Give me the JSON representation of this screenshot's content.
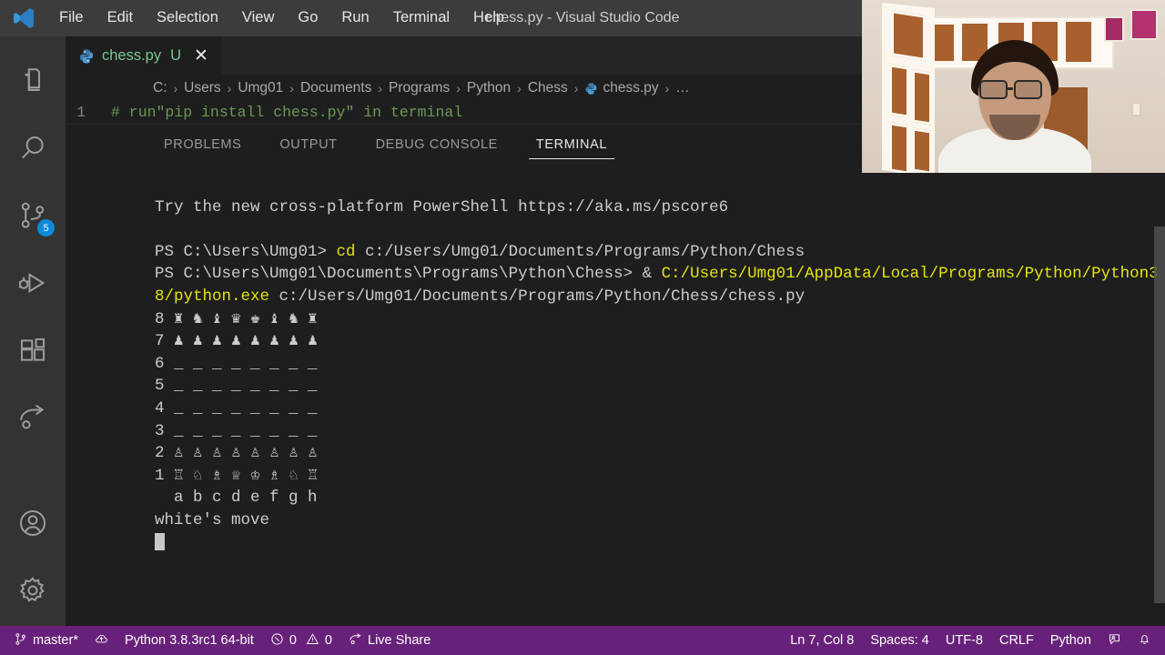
{
  "window": {
    "title": "chess.py - Visual Studio Code"
  },
  "menu": {
    "items": [
      {
        "label": "File"
      },
      {
        "label": "Edit"
      },
      {
        "label": "Selection"
      },
      {
        "label": "View"
      },
      {
        "label": "Go"
      },
      {
        "label": "Run"
      },
      {
        "label": "Terminal"
      },
      {
        "label": "Help"
      }
    ]
  },
  "activitybar": {
    "items": [
      {
        "name": "explorer-icon",
        "badge": ""
      },
      {
        "name": "search-icon",
        "badge": ""
      },
      {
        "name": "source-control-icon",
        "badge": "5"
      },
      {
        "name": "run-and-debug-icon",
        "badge": ""
      },
      {
        "name": "extensions-icon",
        "badge": ""
      },
      {
        "name": "live-share-icon",
        "badge": ""
      },
      {
        "name": "account-icon",
        "badge": ""
      },
      {
        "name": "settings-gear-icon",
        "badge": ""
      }
    ]
  },
  "tab": {
    "icon": "python-file-icon",
    "label": "chess.py",
    "badge": "U",
    "close": "✕"
  },
  "breadcrumbs": {
    "separator": "›",
    "items": [
      {
        "label": "C:"
      },
      {
        "label": "Users"
      },
      {
        "label": "Umg01"
      },
      {
        "label": "Documents"
      },
      {
        "label": "Programs"
      },
      {
        "label": "Python"
      },
      {
        "label": "Chess"
      },
      {
        "label": "chess.py",
        "icon": "python-file-icon"
      },
      {
        "label": "…"
      }
    ]
  },
  "editor": {
    "lines": [
      {
        "number": "1",
        "text": "# run\"pip install chess.py\" in terminal"
      }
    ]
  },
  "panel": {
    "tabs": [
      {
        "label": "PROBLEMS",
        "active": false
      },
      {
        "label": "OUTPUT",
        "active": false
      },
      {
        "label": "DEBUG CONSOLE",
        "active": false
      },
      {
        "label": "TERMINAL",
        "active": true
      }
    ]
  },
  "terminal": {
    "line_banner": "Try the new cross-platform PowerShell https://aka.ms/pscore6",
    "prompt1_prefix": "PS C:\\Users\\Umg01> ",
    "prompt1_cmd": "cd",
    "prompt1_args": " c:/Users/Umg01/Documents/Programs/Python/Chess",
    "prompt2_prefix": "PS C:\\Users\\Umg01\\Documents\\Programs\\Python\\Chess> & ",
    "prompt2_path": "C:/Users/Umg01/AppData/Local/Programs/Python/Python38/python.exe",
    "prompt2_script": " c:/Users/Umg01/Documents/Programs/Python/Chess/chess.py",
    "board": [
      {
        "rank": "8",
        "squares": "♜ ♞ ♝ ♛ ♚ ♝ ♞ ♜"
      },
      {
        "rank": "7",
        "squares": "♟ ♟ ♟ ♟ ♟ ♟ ♟ ♟"
      },
      {
        "rank": "6",
        "squares": "_ _ _ _ _ _ _ _"
      },
      {
        "rank": "5",
        "squares": "_ _ _ _ _ _ _ _"
      },
      {
        "rank": "4",
        "squares": "_ _ _ _ _ _ _ _"
      },
      {
        "rank": "3",
        "squares": "_ _ _ _ _ _ _ _"
      },
      {
        "rank": "2",
        "squares": "♙ ♙ ♙ ♙ ♙ ♙ ♙ ♙"
      },
      {
        "rank": "1",
        "squares": "♖ ♘ ♗ ♕ ♔ ♗ ♘ ♖"
      }
    ],
    "files_row": "  a b c d e f g h",
    "status_line": "white's move"
  },
  "statusbar": {
    "left": [
      {
        "name": "remote-branch",
        "icon": "source-control-icon",
        "label": "master*"
      },
      {
        "name": "sync-changes",
        "icon": "sync-cloud-icon",
        "label": ""
      },
      {
        "name": "python-interpreter",
        "icon": "",
        "label": "Python 3.8.3rc1 64-bit"
      },
      {
        "name": "errors-warnings",
        "icon": "error-warning-icon",
        "label": "0",
        "label2": "0"
      },
      {
        "name": "live-share",
        "icon": "live-share-icon",
        "label": "Live Share"
      }
    ],
    "right": [
      {
        "name": "cursor-position",
        "label": "Ln 7, Col 8"
      },
      {
        "name": "indentation",
        "label": "Spaces: 4"
      },
      {
        "name": "encoding",
        "label": "UTF-8"
      },
      {
        "name": "eol-sequence",
        "label": "CRLF"
      },
      {
        "name": "language-mode",
        "label": "Python"
      },
      {
        "name": "feedback-icon",
        "label": ""
      },
      {
        "name": "notifications-bell-icon",
        "label": ""
      }
    ]
  },
  "colors": {
    "titlebar": "#3c3c3c",
    "activitybar": "#333333",
    "editor": "#1e1e1e",
    "statusbar": "#68217a",
    "accent_badge": "#0e8ad8",
    "terminal_yellow": "#e5e510",
    "tab_green": "#73c991",
    "comment_green": "#6A9955"
  }
}
